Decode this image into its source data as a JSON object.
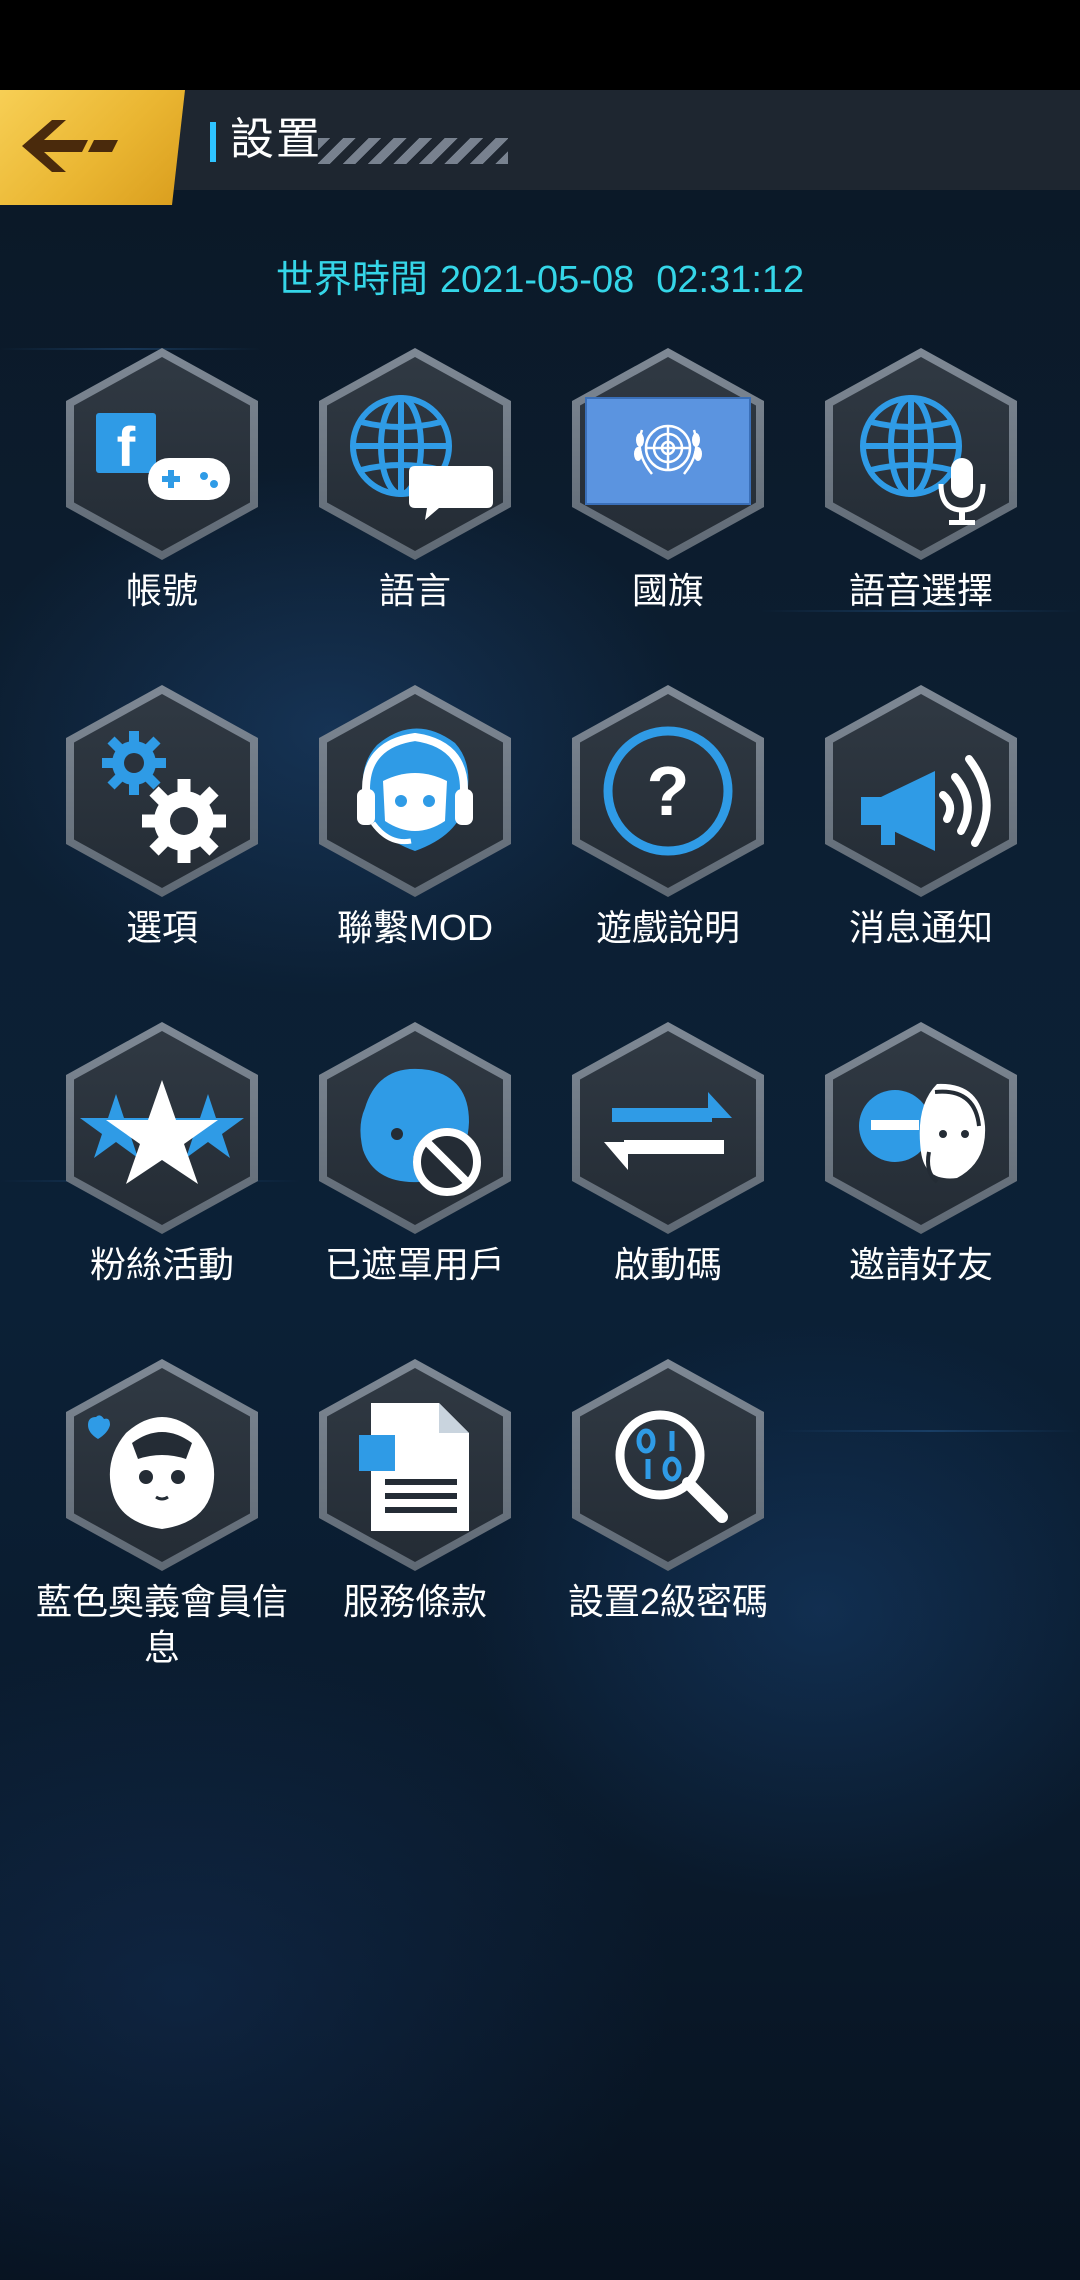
{
  "header": {
    "title": "設置",
    "back_icon": "back-arrow-icon"
  },
  "world_time": {
    "label": "世界時間",
    "date": "2021-05-08",
    "time": "02:31:12"
  },
  "colors": {
    "accent": "#2ec3ff",
    "time_text": "#35d6e8",
    "back_button": "#eab632",
    "icon_blue": "#2f9be6"
  },
  "menu": {
    "items": [
      {
        "label": "帳號",
        "icon": "facebook-gamepad-icon"
      },
      {
        "label": "語言",
        "icon": "globe-chat-icon"
      },
      {
        "label": "國旗",
        "icon": "un-flag-icon"
      },
      {
        "label": "語音選擇",
        "icon": "globe-microphone-icon"
      },
      {
        "label": "選項",
        "icon": "gears-icon"
      },
      {
        "label": "聯繫MOD",
        "icon": "headset-character-icon"
      },
      {
        "label": "遊戲說明",
        "icon": "question-mark-icon"
      },
      {
        "label": "消息通知",
        "icon": "megaphone-icon"
      },
      {
        "label": "粉絲活動",
        "icon": "stars-icon"
      },
      {
        "label": "已遮罩用戶",
        "icon": "blocked-user-icon"
      },
      {
        "label": "啟動碼",
        "icon": "swap-arrows-icon"
      },
      {
        "label": "邀請好友",
        "icon": "friends-icon"
      },
      {
        "label": "藍色奧義會員信息",
        "icon": "member-character-icon"
      },
      {
        "label": "服務條款",
        "icon": "document-icon"
      },
      {
        "label": "設置2級密碼",
        "icon": "binary-search-icon"
      }
    ]
  }
}
